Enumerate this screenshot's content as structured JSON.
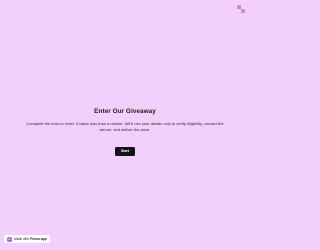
{
  "form": {
    "title": "Enter Our Giveaway",
    "description": "Complete the form to enter. It takes less than a minute. We'll use your details only to verify eligibility, contact the winner, and deliver the prize.",
    "start_label": "Start"
  },
  "badge": {
    "prefix": "Made with",
    "brand": "Fermo.app"
  },
  "colors": {
    "background": "#f3d0fb",
    "button": "#14121b",
    "logo": "#c58be0"
  },
  "icons": {
    "top_logo": "brand-logo-icon",
    "badge_logo": "brand-logo-icon"
  }
}
